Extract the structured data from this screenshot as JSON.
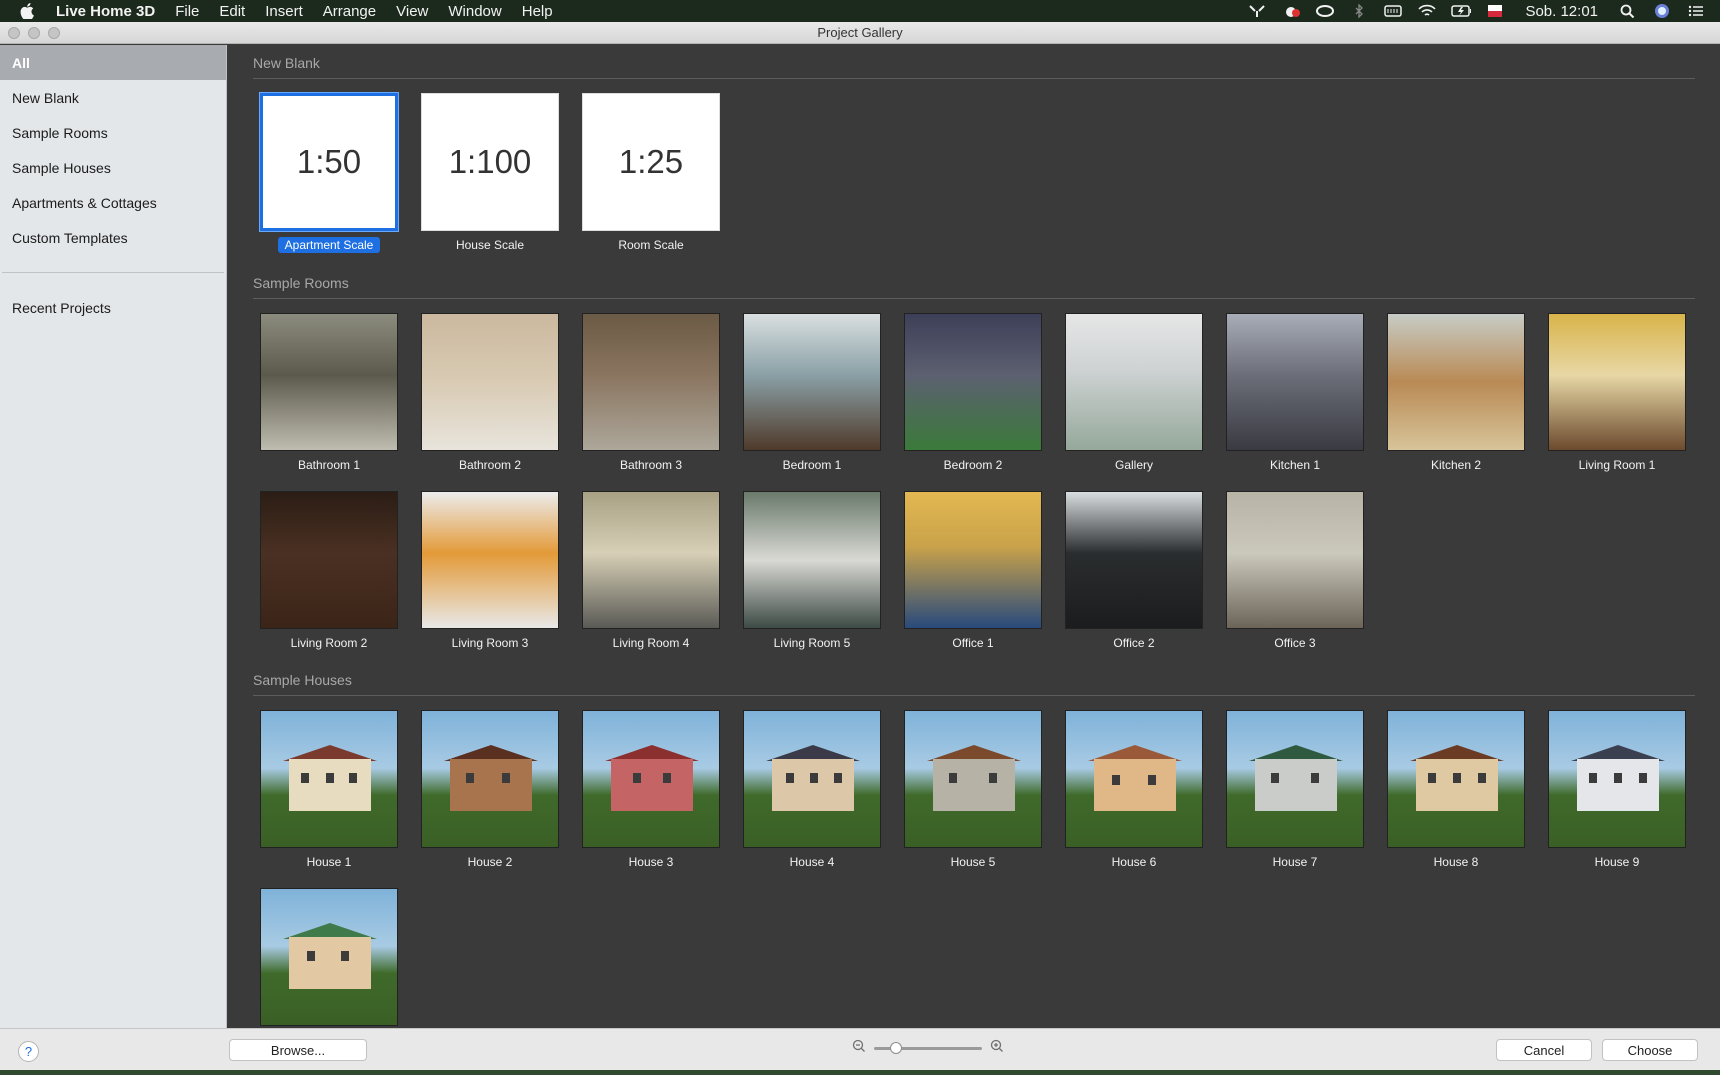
{
  "menubar": {
    "app_name": "Live Home 3D",
    "items": [
      "File",
      "Edit",
      "Insert",
      "Arrange",
      "View",
      "Window",
      "Help"
    ],
    "clock": "Sob. 12:01"
  },
  "window": {
    "title": "Project Gallery"
  },
  "sidebar": {
    "items": [
      "All",
      "New Blank",
      "Sample Rooms",
      "Sample Houses",
      "Apartments & Cottages",
      "Custom Templates"
    ],
    "recent": "Recent Projects"
  },
  "sections": {
    "new_blank": "New Blank",
    "sample_rooms": "Sample Rooms",
    "sample_houses": "Sample Houses"
  },
  "blank_templates": [
    {
      "scale": "1:50",
      "label": "Apartment Scale"
    },
    {
      "scale": "1:100",
      "label": "House Scale"
    },
    {
      "scale": "1:25",
      "label": "Room Scale"
    }
  ],
  "rooms": [
    "Bathroom 1",
    "Bathroom 2",
    "Bathroom 3",
    "Bedroom 1",
    "Bedroom 2",
    "Gallery",
    "Kitchen 1",
    "Kitchen 2",
    "Living Room 1",
    "Living Room 2",
    "Living Room 3",
    "Living Room 4",
    "Living Room 5",
    "Office 1",
    "Office 2",
    "Office 3"
  ],
  "houses": [
    "House 1",
    "House 2",
    "House 3",
    "House 4",
    "House 5",
    "House 6",
    "House 7",
    "House 8",
    "House 9",
    ""
  ],
  "bottom": {
    "help": "?",
    "browse": "Browse...",
    "cancel": "Cancel",
    "choose": "Choose"
  },
  "colors": {
    "accent": "#1d6fe2",
    "content_bg": "#3a3a3a",
    "sidebar_bg": "#e4e7ea"
  }
}
